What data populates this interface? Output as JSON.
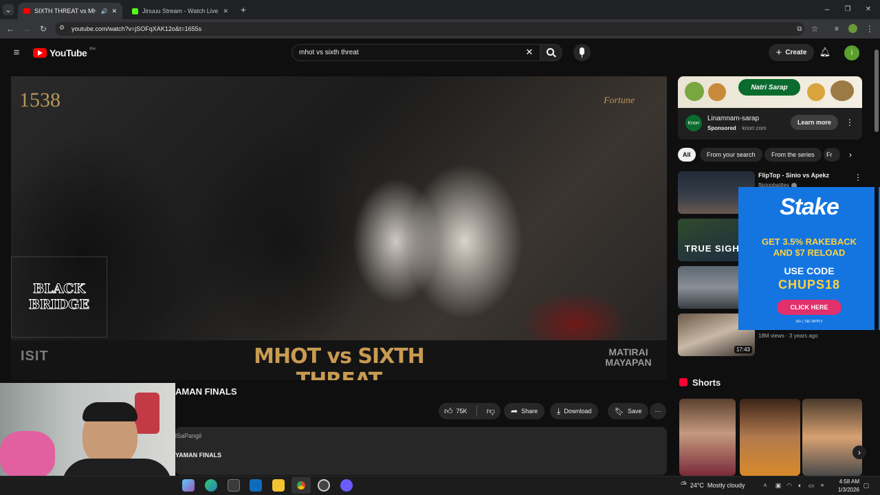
{
  "browser": {
    "tabs": [
      {
        "title": "SIXTH THREAT vs MHOT | M",
        "close": "✕"
      },
      {
        "title": "Jinuuu Stream - Watch Live on",
        "close": "✕"
      }
    ],
    "new_tab": "+",
    "url": "youtube.com/watch?v=jSOFqXAK12o&t=1655s"
  },
  "youtube": {
    "logo_text": "YouTube",
    "region": "PH",
    "search_value": "mhot vs sixth threat",
    "create_label": "Create",
    "avatar_letter": "i"
  },
  "video": {
    "title_partial": "AMAN FINALS",
    "watermark_text": "1538",
    "overlay_text": "MHOT vs SIXTH THREAT",
    "logo_left": "BLACK BRIDGE",
    "banner_left_text": "ISIT",
    "banner_right_text": "MATIRAI MAYAPAN",
    "brand_right": "Fortune",
    "like_count": "75K",
    "share_label": "Share",
    "download_label": "Download",
    "save_label": "Save",
    "channel_partial": "lSaPangil",
    "desc_partial": "YAMAN FINALS"
  },
  "ad": {
    "advertiser": "Linamnam-sarap",
    "sponsored": "Sponsored",
    "domain": "knorr.com",
    "learn_more": "Learn more",
    "banner_text": "Natri Sarap"
  },
  "chips": [
    "All",
    "From your search",
    "From the series",
    "Fr"
  ],
  "recommended": [
    {
      "title": "FlipTop - Sinio vs Apekz",
      "channel": "fliptopbattles",
      "meta": "",
      "duration": ""
    },
    {
      "title": "",
      "channel": "",
      "meta": "",
      "duration": "",
      "thumb_text": "TRUE SIGH"
    },
    {
      "title": "",
      "channel": "",
      "meta": "",
      "duration": ""
    },
    {
      "title": "",
      "channel": "",
      "meta": "18M views · 3 years ago",
      "duration": "17:43"
    }
  ],
  "stake_ad": {
    "brand": "Stake",
    "line1": "GET 3.5% RAKEBACK",
    "line2": "AND $7 RELOAD",
    "code_label": "USE CODE",
    "code": "CHUPS18",
    "cta": "CLICK HERE",
    "fineprint": "18+ | T&C APPLY"
  },
  "shorts": {
    "heading": "Shorts"
  },
  "taskbar": {
    "weather_temp": "24°C",
    "weather_desc": "Mostly cloudy",
    "time": "4:58 AM",
    "date": "1/3/2026"
  },
  "colors": {
    "youtube_red": "#ff0000",
    "stake_blue": "#1475e1",
    "stake_cta": "#e1306c",
    "ad_green": "#0a6b2e"
  }
}
